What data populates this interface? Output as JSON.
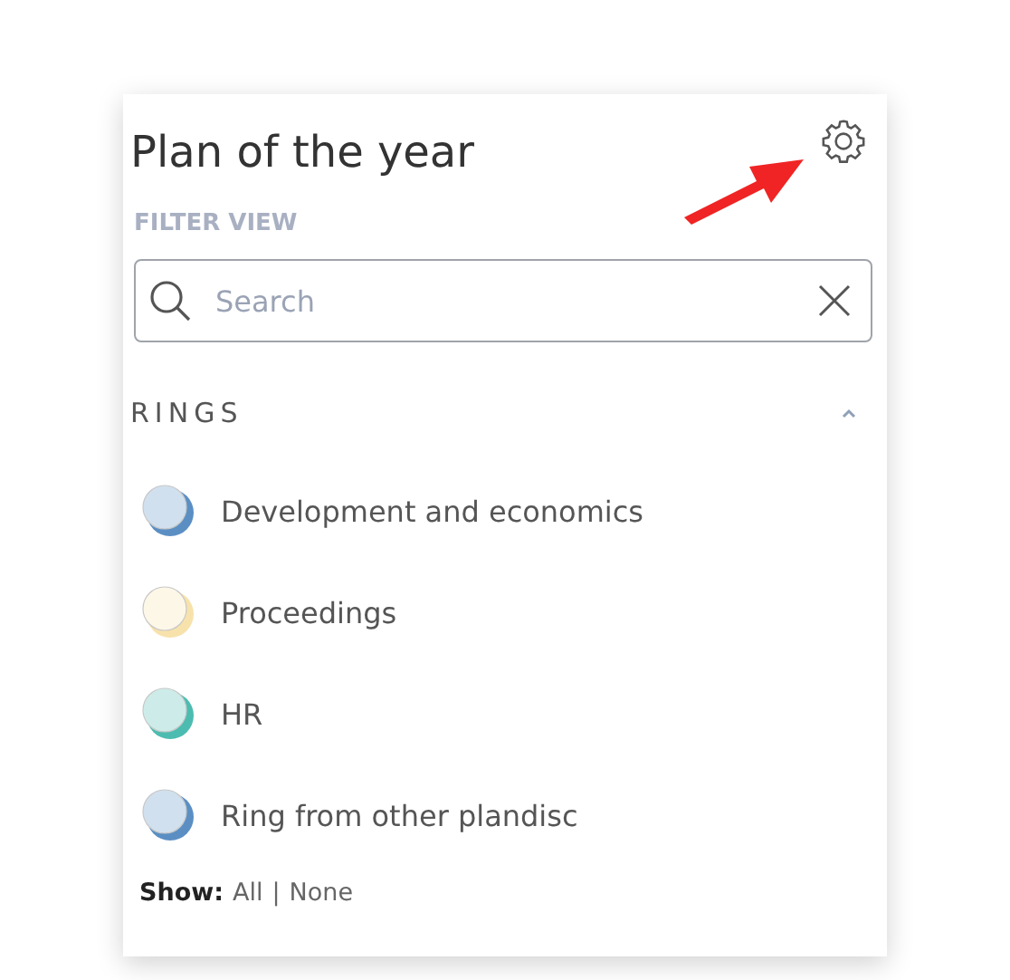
{
  "title": "Plan of the year",
  "filter_label": "FILTER VIEW",
  "search": {
    "placeholder": "Search"
  },
  "section": {
    "title": "RINGS",
    "expanded": true
  },
  "rings": [
    {
      "label": "Development and economics",
      "color": "#5b8fc4"
    },
    {
      "label": "Proceedings",
      "color": "#f8e2ac"
    },
    {
      "label": "HR",
      "color": "#4dbcb0"
    },
    {
      "label": "Ring from other plandisc",
      "color": "#5b8fc4"
    }
  ],
  "show": {
    "label": "Show:",
    "options": [
      "All",
      "None"
    ],
    "separator": "|"
  }
}
